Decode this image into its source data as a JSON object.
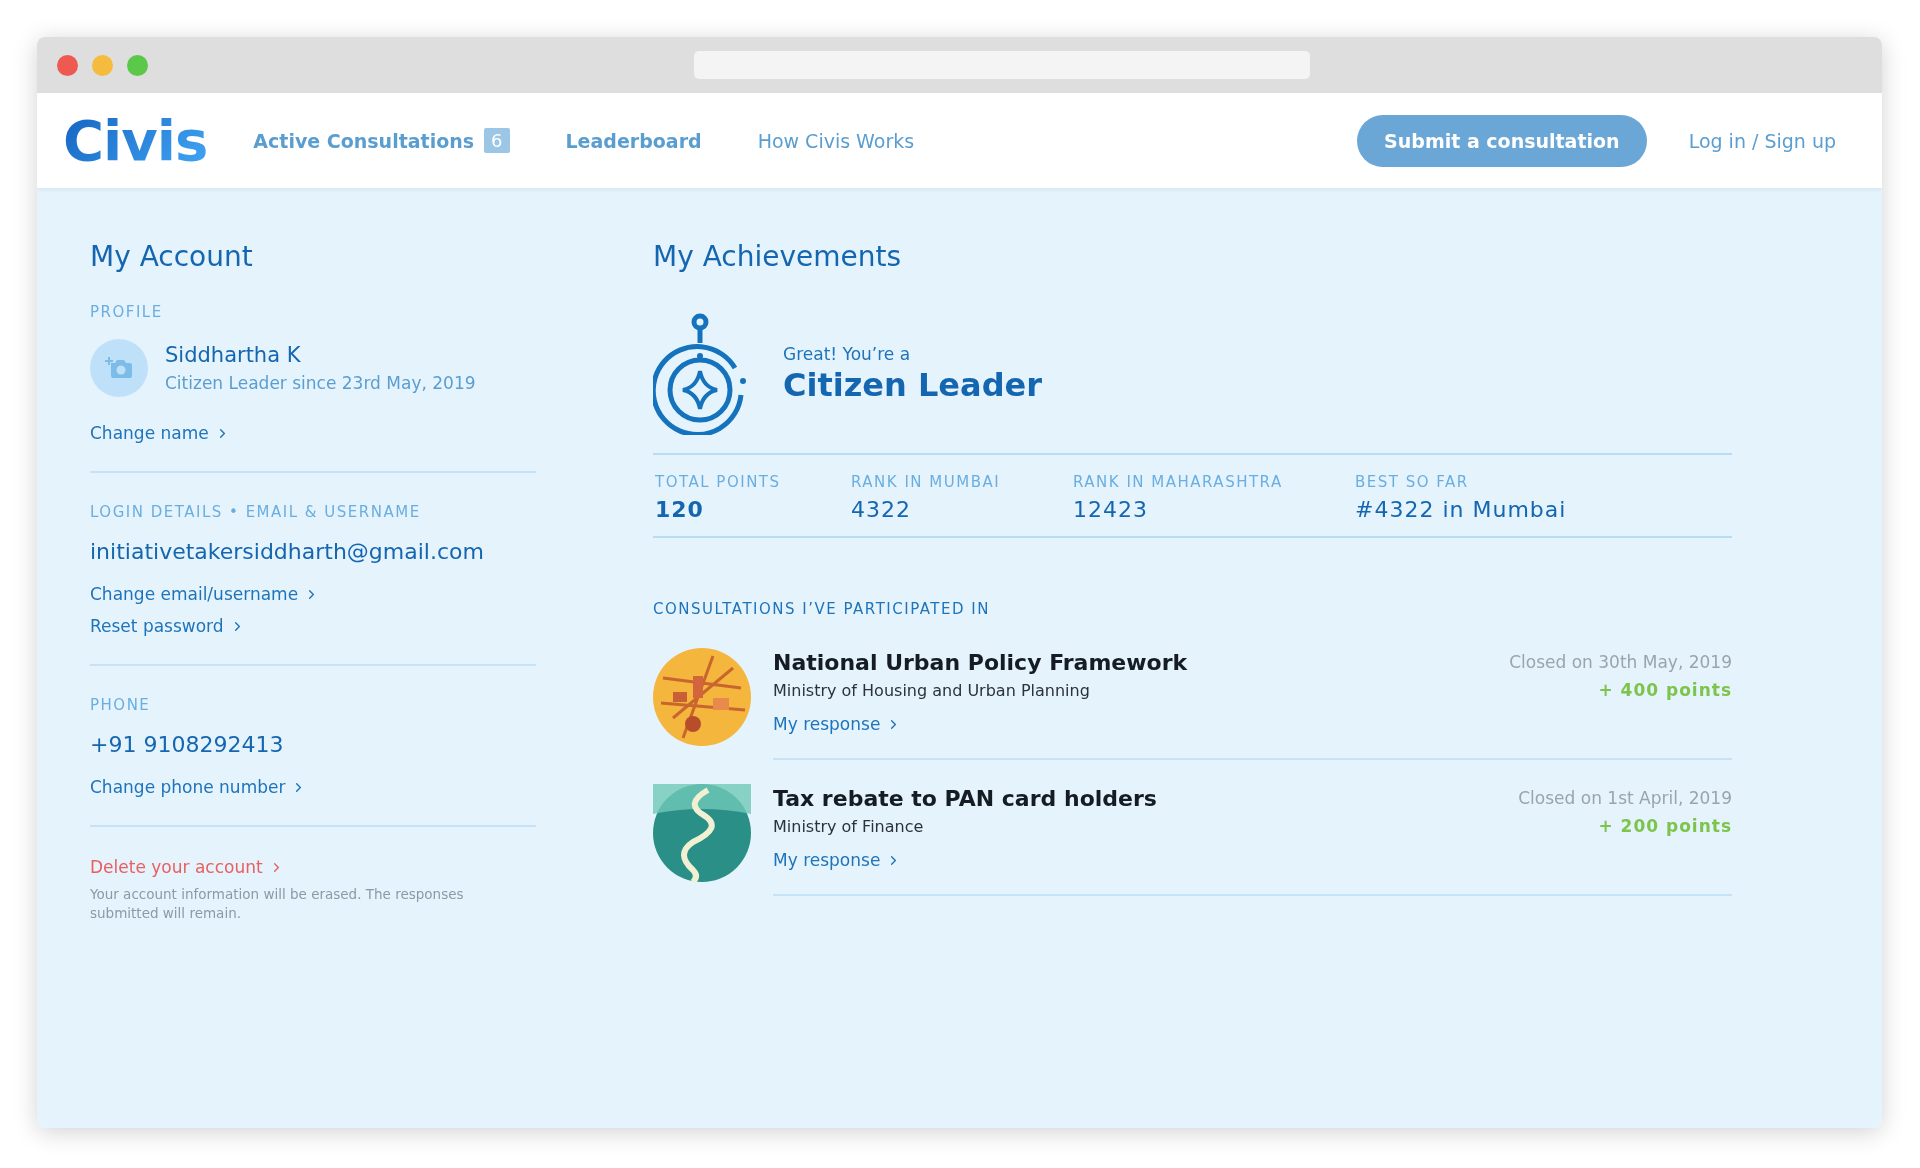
{
  "nav": {
    "logo": "Civis",
    "links": [
      {
        "label": "Active Consultations",
        "count": "6",
        "bold": true
      },
      {
        "label": "Leaderboard",
        "bold": true
      },
      {
        "label": "How Civis Works",
        "bold": false
      }
    ],
    "cta": "Submit a consultation",
    "auth": "Log in / Sign up"
  },
  "account": {
    "title": "My Account",
    "profile": {
      "label": "PROFILE",
      "name": "Siddhartha K",
      "since": "Citizen Leader since 23rd May, 2019",
      "link": "Change name"
    },
    "login": {
      "label": "LOGIN DETAILS • EMAIL & USERNAME",
      "email": "initiativetakersiddharth@gmail.com",
      "links": [
        "Change email/username",
        "Reset password"
      ]
    },
    "phone": {
      "label": "PHONE",
      "number": "+91 9108292413",
      "link": "Change phone number"
    },
    "delete": {
      "link": "Delete your account",
      "note": "Your account information will be erased. The responses submitted will remain."
    }
  },
  "achievements": {
    "title": "My Achievements",
    "intro": "Great! You’re a",
    "level": "Citizen Leader",
    "stats": [
      {
        "label": "TOTAL POINTS",
        "value": "120",
        "bold": true
      },
      {
        "label": "RANK IN MUMBAI",
        "value": "4322",
        "bold": false
      },
      {
        "label": "RANK IN MAHARASHTRA",
        "value": "12423",
        "bold": false
      },
      {
        "label": "BEST SO FAR",
        "value": "#4322 in Mumbai",
        "bold": false
      }
    ],
    "consultations_heading": "CONSULTATIONS I’VE PARTICIPATED IN",
    "consultations": [
      {
        "kind": "city",
        "title": "National Urban Policy Framework",
        "ministry": "Ministry of Housing and Urban Planning",
        "link": "My response",
        "closed": "Closed on 30th May, 2019",
        "points": "+ 400 points"
      },
      {
        "kind": "river",
        "title": "Tax rebate to PAN card holders",
        "ministry": "Ministry of Finance",
        "link": "My response",
        "closed": "Closed on 1st April, 2019",
        "points": "+ 200 points"
      }
    ]
  }
}
